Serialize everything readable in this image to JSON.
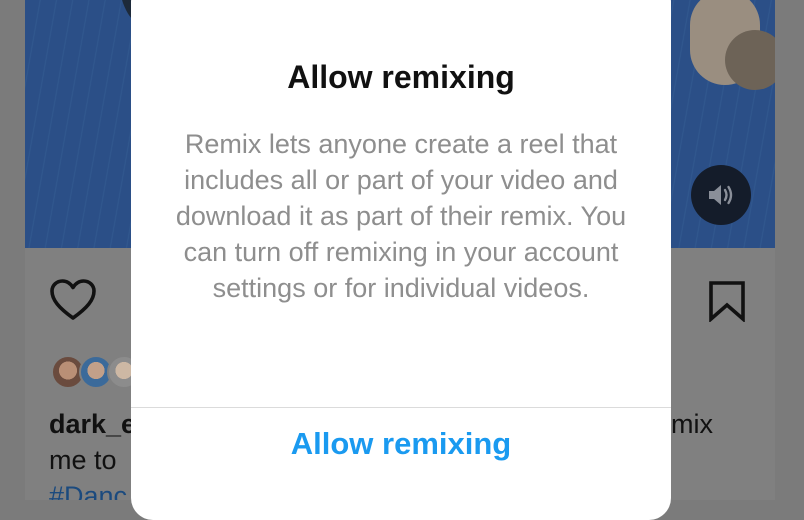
{
  "post": {
    "caption_user": "dark_e",
    "caption_right": "mix",
    "caption_line2": "me to",
    "caption_tag": "#Danc"
  },
  "icons": {
    "heart": "heart-icon",
    "bookmark": "bookmark-icon",
    "sound": "speaker-icon"
  },
  "modal": {
    "title": "Allow remixing",
    "body": "Remix lets anyone create a reel that includes all or part of your video and download it as part of their remix. You can turn off remixing in your account settings or for individual videos.",
    "primary_action": "Allow remixing"
  },
  "colors": {
    "accent": "#1a9af0",
    "overlay": "#808080"
  }
}
